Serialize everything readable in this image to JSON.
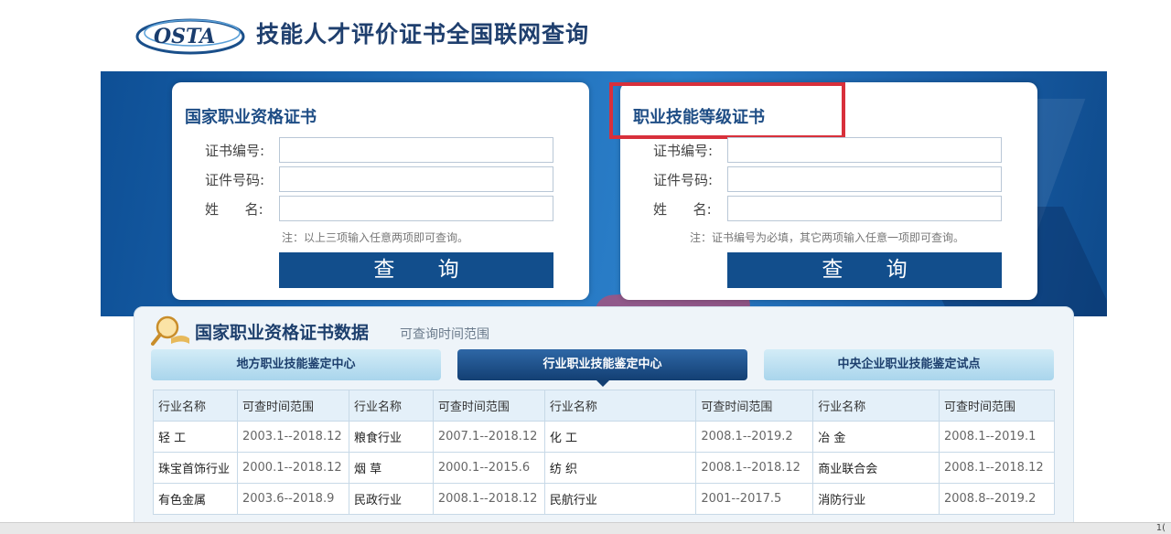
{
  "header": {
    "logo_text": "OSTA",
    "title": "技能人才评价证书全国联网查询"
  },
  "colors": {
    "brand_blue": "#124e8c",
    "highlight_red": "#d8303b"
  },
  "panels": {
    "left": {
      "title": "国家职业资格证书",
      "fields": [
        {
          "label": "证书编号:",
          "value": ""
        },
        {
          "label": "证件号码:",
          "value": ""
        },
        {
          "label": "姓      名:",
          "value": ""
        }
      ],
      "note": "注：以上三项输入任意两项即可查询。",
      "button": "查 询"
    },
    "right": {
      "title": "职业技能等级证书",
      "fields": [
        {
          "label": "证书编号:",
          "value": ""
        },
        {
          "label": "证件号码:",
          "value": ""
        },
        {
          "label": "姓      名:",
          "value": ""
        }
      ],
      "note": "注：证书编号为必填，其它两项输入任意一项即可查询。",
      "button": "查 询"
    }
  },
  "data_section": {
    "title": "国家职业资格证书数据",
    "subtitle": "可查询时间范围",
    "tabs": [
      {
        "label": "地方职业技能鉴定中心",
        "active": false
      },
      {
        "label": "行业职业技能鉴定中心",
        "active": true
      },
      {
        "label": "中央企业职业技能鉴定试点",
        "active": false
      }
    ],
    "table": {
      "headers": [
        "行业名称",
        "可查时间范围",
        "行业名称",
        "可查时间范围",
        "行业名称",
        "可查时间范围",
        "行业名称",
        "可查时间范围"
      ],
      "rows": [
        [
          "轻 工",
          "2003.1--2018.12",
          "粮食行业",
          "2007.1--2018.12",
          "化 工",
          "2008.1--2019.2",
          "冶 金",
          "2008.1--2019.1"
        ],
        [
          "珠宝首饰行业",
          "2000.1--2018.12",
          "烟 草",
          "2000.1--2015.6",
          "纺 织",
          "2008.1--2018.12",
          "商业联合会",
          "2008.1--2018.12"
        ],
        [
          "有色金属",
          "2003.6--2018.9",
          "民政行业",
          "2008.1--2018.12",
          "民航行业",
          "2001--2017.5",
          "消防行业",
          "2008.8--2019.2"
        ]
      ]
    }
  },
  "status_bar": {
    "zoom": "1("
  }
}
